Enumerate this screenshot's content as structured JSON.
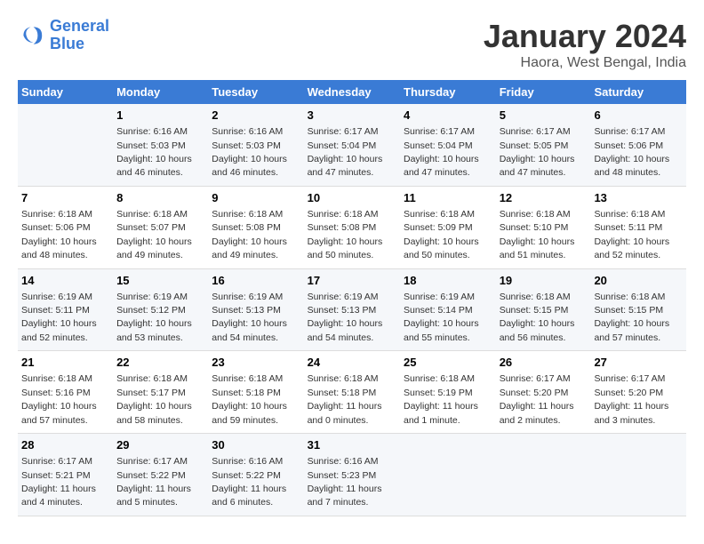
{
  "header": {
    "logo_line1": "General",
    "logo_line2": "Blue",
    "title": "January 2024",
    "subtitle": "Haora, West Bengal, India"
  },
  "columns": [
    "Sunday",
    "Monday",
    "Tuesday",
    "Wednesday",
    "Thursday",
    "Friday",
    "Saturday"
  ],
  "weeks": [
    [
      {
        "day": "",
        "info": ""
      },
      {
        "day": "1",
        "info": "Sunrise: 6:16 AM\nSunset: 5:03 PM\nDaylight: 10 hours\nand 46 minutes."
      },
      {
        "day": "2",
        "info": "Sunrise: 6:16 AM\nSunset: 5:03 PM\nDaylight: 10 hours\nand 46 minutes."
      },
      {
        "day": "3",
        "info": "Sunrise: 6:17 AM\nSunset: 5:04 PM\nDaylight: 10 hours\nand 47 minutes."
      },
      {
        "day": "4",
        "info": "Sunrise: 6:17 AM\nSunset: 5:04 PM\nDaylight: 10 hours\nand 47 minutes."
      },
      {
        "day": "5",
        "info": "Sunrise: 6:17 AM\nSunset: 5:05 PM\nDaylight: 10 hours\nand 47 minutes."
      },
      {
        "day": "6",
        "info": "Sunrise: 6:17 AM\nSunset: 5:06 PM\nDaylight: 10 hours\nand 48 minutes."
      }
    ],
    [
      {
        "day": "7",
        "info": "Sunrise: 6:18 AM\nSunset: 5:06 PM\nDaylight: 10 hours\nand 48 minutes."
      },
      {
        "day": "8",
        "info": "Sunrise: 6:18 AM\nSunset: 5:07 PM\nDaylight: 10 hours\nand 49 minutes."
      },
      {
        "day": "9",
        "info": "Sunrise: 6:18 AM\nSunset: 5:08 PM\nDaylight: 10 hours\nand 49 minutes."
      },
      {
        "day": "10",
        "info": "Sunrise: 6:18 AM\nSunset: 5:08 PM\nDaylight: 10 hours\nand 50 minutes."
      },
      {
        "day": "11",
        "info": "Sunrise: 6:18 AM\nSunset: 5:09 PM\nDaylight: 10 hours\nand 50 minutes."
      },
      {
        "day": "12",
        "info": "Sunrise: 6:18 AM\nSunset: 5:10 PM\nDaylight: 10 hours\nand 51 minutes."
      },
      {
        "day": "13",
        "info": "Sunrise: 6:18 AM\nSunset: 5:11 PM\nDaylight: 10 hours\nand 52 minutes."
      }
    ],
    [
      {
        "day": "14",
        "info": "Sunrise: 6:19 AM\nSunset: 5:11 PM\nDaylight: 10 hours\nand 52 minutes."
      },
      {
        "day": "15",
        "info": "Sunrise: 6:19 AM\nSunset: 5:12 PM\nDaylight: 10 hours\nand 53 minutes."
      },
      {
        "day": "16",
        "info": "Sunrise: 6:19 AM\nSunset: 5:13 PM\nDaylight: 10 hours\nand 54 minutes."
      },
      {
        "day": "17",
        "info": "Sunrise: 6:19 AM\nSunset: 5:13 PM\nDaylight: 10 hours\nand 54 minutes."
      },
      {
        "day": "18",
        "info": "Sunrise: 6:19 AM\nSunset: 5:14 PM\nDaylight: 10 hours\nand 55 minutes."
      },
      {
        "day": "19",
        "info": "Sunrise: 6:18 AM\nSunset: 5:15 PM\nDaylight: 10 hours\nand 56 minutes."
      },
      {
        "day": "20",
        "info": "Sunrise: 6:18 AM\nSunset: 5:15 PM\nDaylight: 10 hours\nand 57 minutes."
      }
    ],
    [
      {
        "day": "21",
        "info": "Sunrise: 6:18 AM\nSunset: 5:16 PM\nDaylight: 10 hours\nand 57 minutes."
      },
      {
        "day": "22",
        "info": "Sunrise: 6:18 AM\nSunset: 5:17 PM\nDaylight: 10 hours\nand 58 minutes."
      },
      {
        "day": "23",
        "info": "Sunrise: 6:18 AM\nSunset: 5:18 PM\nDaylight: 10 hours\nand 59 minutes."
      },
      {
        "day": "24",
        "info": "Sunrise: 6:18 AM\nSunset: 5:18 PM\nDaylight: 11 hours\nand 0 minutes."
      },
      {
        "day": "25",
        "info": "Sunrise: 6:18 AM\nSunset: 5:19 PM\nDaylight: 11 hours\nand 1 minute."
      },
      {
        "day": "26",
        "info": "Sunrise: 6:17 AM\nSunset: 5:20 PM\nDaylight: 11 hours\nand 2 minutes."
      },
      {
        "day": "27",
        "info": "Sunrise: 6:17 AM\nSunset: 5:20 PM\nDaylight: 11 hours\nand 3 minutes."
      }
    ],
    [
      {
        "day": "28",
        "info": "Sunrise: 6:17 AM\nSunset: 5:21 PM\nDaylight: 11 hours\nand 4 minutes."
      },
      {
        "day": "29",
        "info": "Sunrise: 6:17 AM\nSunset: 5:22 PM\nDaylight: 11 hours\nand 5 minutes."
      },
      {
        "day": "30",
        "info": "Sunrise: 6:16 AM\nSunset: 5:22 PM\nDaylight: 11 hours\nand 6 minutes."
      },
      {
        "day": "31",
        "info": "Sunrise: 6:16 AM\nSunset: 5:23 PM\nDaylight: 11 hours\nand 7 minutes."
      },
      {
        "day": "",
        "info": ""
      },
      {
        "day": "",
        "info": ""
      },
      {
        "day": "",
        "info": ""
      }
    ]
  ]
}
